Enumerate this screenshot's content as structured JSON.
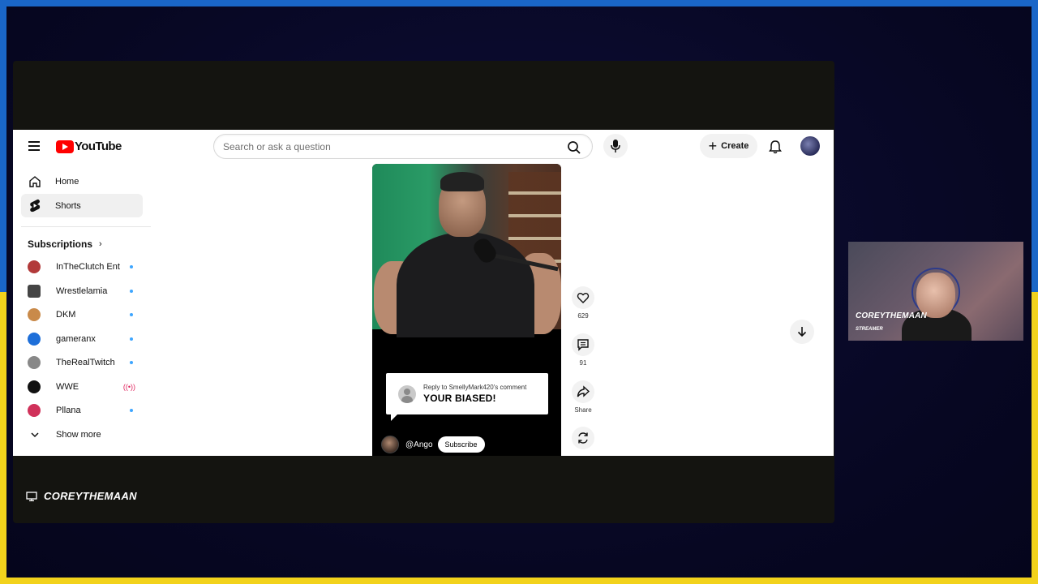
{
  "app": {
    "name": "YouTube"
  },
  "search": {
    "placeholder": "Search or ask a question"
  },
  "header": {
    "create_label": "Create"
  },
  "sidebar": {
    "items": [
      {
        "label": "Home",
        "icon": "home-icon"
      },
      {
        "label": "Shorts",
        "icon": "shorts-icon",
        "active": true
      }
    ],
    "subscriptions_title": "Subscriptions",
    "subscriptions": [
      {
        "label": "InTheClutch Ent",
        "status": "new-content",
        "color": "#b23a3a"
      },
      {
        "label": "Wrestlelamia",
        "status": "new-content",
        "color": "#444444"
      },
      {
        "label": "DKM",
        "status": "new-content",
        "color": "#c98a4a"
      },
      {
        "label": "gameranx",
        "status": "new-content",
        "color": "#1e6fd9"
      },
      {
        "label": "TheRealTwitch",
        "status": "new-content",
        "color": "#888888"
      },
      {
        "label": "WWE",
        "status": "live",
        "color": "#111111"
      },
      {
        "label": "Pllana",
        "status": "new-content",
        "color": "#d0315a"
      }
    ],
    "show_more_label": "Show more"
  },
  "short": {
    "reply_to": "Reply to SmellyMark420's comment",
    "reply_text": "YOUR BIASED!",
    "channel_handle": "@Ango",
    "subscribe_label": "Subscribe",
    "actions": {
      "like_count": "629",
      "comment_count": "91",
      "share_label": "Share"
    }
  },
  "overlay": {
    "caption": "COREYTHEMAAN",
    "webcam_name": "COREYTHEMAAN",
    "webcam_role": "STREAMER"
  },
  "colors": {
    "brand_red": "#ff0000",
    "frame_blue": "#1a66c8",
    "frame_yellow": "#f2d21c",
    "new_content_dot": "#3ea6ff",
    "live_red": "#e0245e"
  }
}
